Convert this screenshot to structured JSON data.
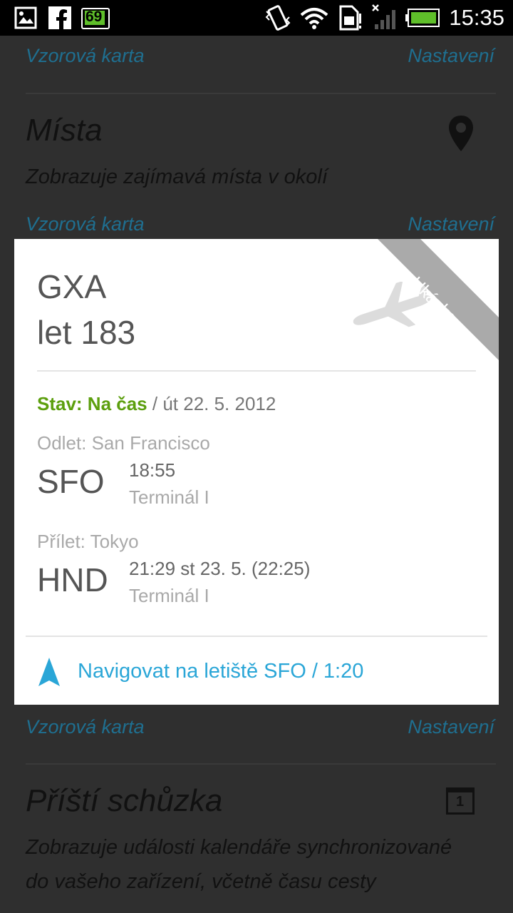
{
  "status_bar": {
    "time": "15:35",
    "notification_badge": "69",
    "icons": [
      "gallery-icon",
      "facebook-icon",
      "battery-notification-icon",
      "vibrate-icon",
      "wifi-icon",
      "sim-icon",
      "signal-icon",
      "battery-icon"
    ]
  },
  "background": {
    "links": [
      {
        "left": "Vzorová karta",
        "right": "Nastavení"
      },
      {
        "left": "Vzorová karta",
        "right": "Nastavení"
      },
      {
        "left": "Vzorová karta",
        "right": "Nastavení"
      }
    ],
    "places": {
      "title": "Místa",
      "description": "Zobrazuje zajímavá místa v okolí",
      "icon": "location-pin-icon"
    },
    "appointment": {
      "title": "Příští schůzka",
      "description_line1": "Zobrazuje události kalendáře synchronizované",
      "description_line2": "do vašeho zařízení, včetně času cesty",
      "calendar_day": "1",
      "icon": "calendar-icon"
    }
  },
  "card": {
    "airline": "GXA",
    "flight": "let 183",
    "ribbon": "Ukázka",
    "status_label": "Stav: Na čas",
    "date": " / út 22. 5. 2012",
    "departure": {
      "label": "Odlet: San Francisco",
      "code": "SFO",
      "time": "18:55",
      "terminal": "Terminál I"
    },
    "arrival": {
      "label": "Přílet: Tokyo",
      "code": "HND",
      "time": "21:29 st 23. 5. (22:25)",
      "terminal": "Terminál I"
    },
    "navigate": "Navigovat na letiště SFO / 1:20"
  },
  "colors": {
    "status_green": "#5c9f0e",
    "link_blue": "#2aa6d7",
    "ribbon_gray": "#aaaaaa"
  }
}
